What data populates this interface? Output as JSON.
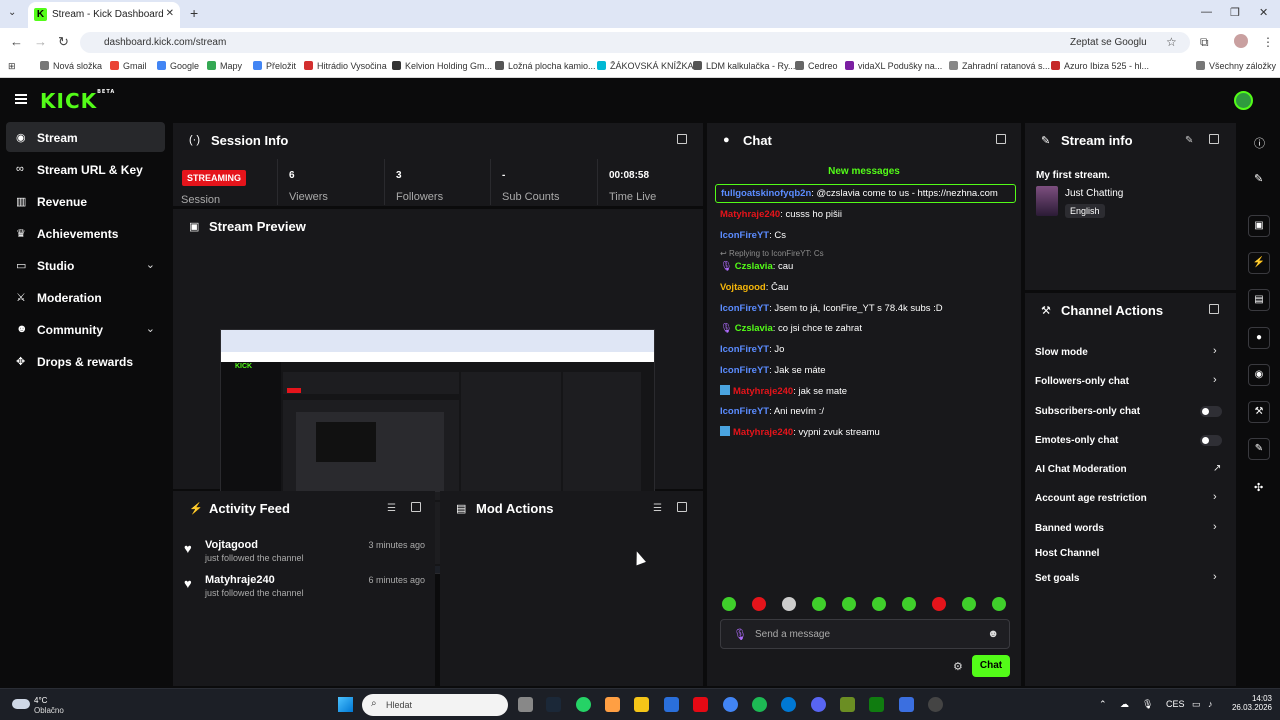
{
  "browser": {
    "tab_title": "Stream - Kick Dashboard",
    "url": "dashboard.kick.com/stream",
    "ask_google": "Zeptat se Googlu",
    "bookmarks": [
      "Nová složka",
      "Gmail",
      "Google",
      "Mapy",
      "Přeložit",
      "Hitrádio Vysočina",
      "Kelvion Holding Gm...",
      "Ložná plocha kamio...",
      "ŽÁKOVSKÁ KNÍŽKA",
      "LDM kalkulačka - Ry...",
      "Cedreo",
      "vidaXL Podušky na...",
      "Zahradní ratanová s...",
      "Azuro Ibiza 525 - hl...",
      "Všechny záložky"
    ]
  },
  "header": {
    "logo": "KICK",
    "logo_sup": "BETA"
  },
  "sidebar": {
    "items": [
      {
        "label": "Stream",
        "icon": "broadcast-icon"
      },
      {
        "label": "Stream URL & Key",
        "icon": "link-icon"
      },
      {
        "label": "Revenue",
        "icon": "chart-icon"
      },
      {
        "label": "Achievements",
        "icon": "trophy-icon"
      },
      {
        "label": "Studio",
        "icon": "studio-icon"
      },
      {
        "label": "Moderation",
        "icon": "sword-icon"
      },
      {
        "label": "Community",
        "icon": "users-icon"
      },
      {
        "label": "Drops & rewards",
        "icon": "gift-icon"
      }
    ]
  },
  "session": {
    "title": "Session Info",
    "status": "STREAMING",
    "session_label": "Session",
    "stats": [
      {
        "value": "6",
        "label": "Viewers"
      },
      {
        "value": "3",
        "label": "Followers"
      },
      {
        "value": "-",
        "label": "Sub Counts"
      },
      {
        "value": "00:08:58",
        "label": "Time Live"
      }
    ]
  },
  "preview": {
    "title": "Stream Preview"
  },
  "activity": {
    "title": "Activity Feed",
    "items": [
      {
        "name": "Vojtagood",
        "text": "just followed the channel",
        "time": "3 minutes ago"
      },
      {
        "name": "Matyhraje240",
        "text": "just followed the channel",
        "time": "6 minutes ago"
      }
    ]
  },
  "mod_actions": {
    "title": "Mod Actions"
  },
  "chat": {
    "title": "Chat",
    "new_messages": "New messages",
    "messages": [
      {
        "user": "fullgoatskinofyqb2n",
        "text": ": @czslavia come to us - https://nezhna.com",
        "color": "#5b8cff"
      },
      {
        "user": "Matyhraje240",
        "text": ": cusss ho pišii",
        "color": "#e5141b"
      },
      {
        "user": "IconFireYT",
        "text": ": Cs",
        "color": "#5b8cff"
      },
      {
        "user": "Czslavia",
        "text": ": cau",
        "color": "#53fc18"
      },
      {
        "user": "Vojtagood",
        "text": ": Čau",
        "color": "#f5b60a"
      },
      {
        "user": "IconFireYT",
        "text": ": Jsem to já, IconFire_YT s 78.4k subs :D",
        "color": "#5b8cff"
      },
      {
        "user": "Czslavia",
        "text": ": co jsi chce te zahrat",
        "color": "#53fc18"
      },
      {
        "user": "IconFireYT",
        "text": ": Jo",
        "color": "#5b8cff"
      },
      {
        "user": "IconFireYT",
        "text": ": Jak se máte",
        "color": "#5b8cff"
      },
      {
        "user": "Matyhraje240",
        "text": ": jak se mate",
        "color": "#e5141b"
      },
      {
        "user": "IconFireYT",
        "text": ": Ani nevím :/",
        "color": "#5b8cff"
      },
      {
        "user": "Matyhraje240",
        "text": ": vypni zvuk streamu",
        "color": "#e5141b"
      }
    ],
    "replying": "Replying to IconFireYT: Cs",
    "input_placeholder": "Send a message",
    "send_label": "Chat"
  },
  "stream_info": {
    "title": "Stream info",
    "stream_title": "My first stream.",
    "category": "Just Chatting",
    "language": "English"
  },
  "channel_actions": {
    "title": "Channel Actions",
    "items": [
      {
        "label": "Slow mode",
        "control": "chevron"
      },
      {
        "label": "Followers-only chat",
        "control": "chevron"
      },
      {
        "label": "Subscribers-only chat",
        "control": "toggle"
      },
      {
        "label": "Emotes-only chat",
        "control": "toggle"
      },
      {
        "label": "AI Chat Moderation",
        "control": "external"
      },
      {
        "label": "Account age restriction",
        "control": "chevron"
      },
      {
        "label": "Banned words",
        "control": "chevron"
      },
      {
        "label": "Host Channel",
        "control": "none"
      },
      {
        "label": "Set goals",
        "control": "chevron"
      }
    ]
  },
  "taskbar": {
    "temp": "4°C",
    "weather": "Oblačno",
    "search": "Hledat",
    "lang": "CES",
    "time": "14:03",
    "date": "26.03.2026"
  }
}
